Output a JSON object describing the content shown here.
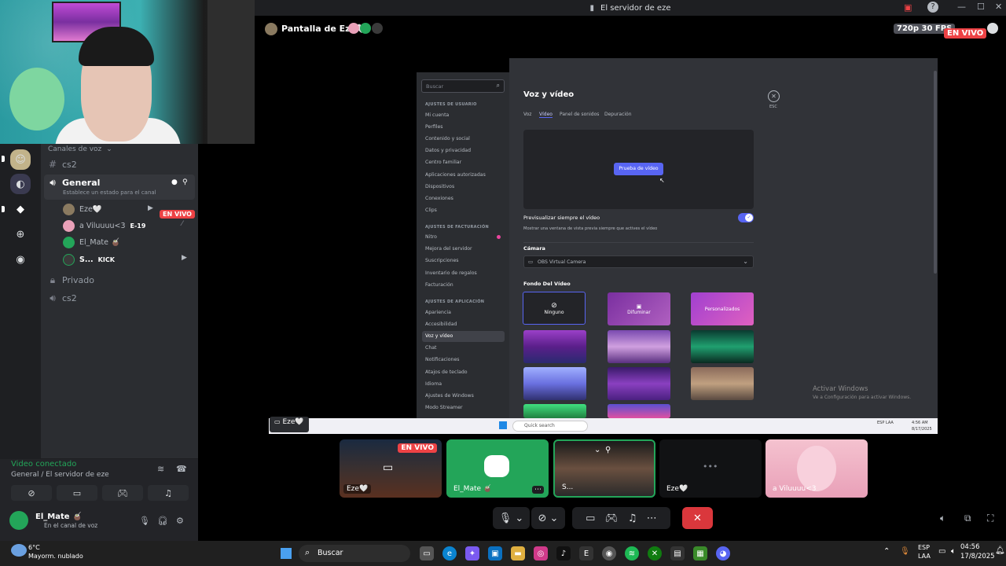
{
  "window": {
    "title": "El servidor de eze"
  },
  "stream": {
    "title": "Pantalla de Eze🤍",
    "quality": "720p 30 FPS",
    "live_badge": "EN VIVO"
  },
  "sidebar": {
    "category": "Canales de voz",
    "channels": [
      {
        "name": "cs2",
        "type": "text"
      },
      {
        "name": "General",
        "type": "voice",
        "status": "Establece un estado para el canal"
      },
      {
        "name": "Privado",
        "type": "locked"
      },
      {
        "name": "cs2",
        "type": "voice"
      }
    ],
    "voice_users": [
      {
        "name": "Eze🤍",
        "live": "EN VIVO"
      },
      {
        "name": "a Viluuuu<3",
        "tag": "E-19"
      },
      {
        "name": "El_Mate 🧉"
      },
      {
        "name": "S...",
        "tag": "KICK"
      }
    ]
  },
  "voice_panel": {
    "status": "Video conectado",
    "location": "General / El servidor de eze",
    "user_name": "El_Mate 🧉",
    "user_status": "En el canal de voz"
  },
  "settings": {
    "search_placeholder": "Buscar",
    "user_header": "AJUSTES DE USUARIO",
    "user_items": [
      "Mi cuenta",
      "Perfiles",
      "Contenido y social",
      "Datos y privacidad",
      "Centro familiar",
      "Aplicaciones autorizadas",
      "Dispositivos",
      "Conexiones",
      "Clips"
    ],
    "billing_header": "AJUSTES DE FACTURACIÓN",
    "billing_items": [
      "Nitro",
      "Mejora del servidor",
      "Suscripciones",
      "Inventario de regalos",
      "Facturación"
    ],
    "app_header": "AJUSTES DE APLICACIÓN",
    "app_items": [
      "Apariencia",
      "Accesibilidad",
      "Voz y vídeo",
      "Chat",
      "Notificaciones",
      "Atajos de teclado",
      "Idioma",
      "Ajustes de Windows",
      "Modo Streamer"
    ],
    "page_title": "Voz y vídeo",
    "tabs": [
      "Voz",
      "Vídeo",
      "Panel de sonidos",
      "Depuración"
    ],
    "test_button": "Prueba de vídeo",
    "preview_label": "Previsualizar siempre el vídeo",
    "preview_desc": "Mostrar una ventana de vista previa siempre que actives el vídeo",
    "camera_label": "Cámara",
    "camera_value": "OBS Virtual Camera",
    "bg_label": "Fondo Del Vídeo",
    "bg_none": "Ninguno",
    "bg_blur": "Difuminar",
    "bg_custom": "Personalizados",
    "esc": "ESC",
    "activate_title": "Activar Windows",
    "activate_desc": "Ve a Configuración para activar Windows."
  },
  "inner_taskbar": {
    "search": "Quick search",
    "lang": "ESP LAA",
    "time": "4:56 AM",
    "date": "8/17/2025",
    "eze_label": "Eze🤍"
  },
  "tiles": [
    {
      "name": "Eze🤍",
      "badge": "EN VIVO"
    },
    {
      "name": "El_Mate 🧉"
    },
    {
      "name": "S..."
    },
    {
      "name": "Eze🤍"
    },
    {
      "name": "a Viluuuu<3"
    }
  ],
  "windows_taskbar": {
    "weather_temp": "6°C",
    "weather_desc": "Mayorm. nublado",
    "search": "Buscar",
    "lang1": "ESP",
    "lang2": "LAA",
    "time": "04:56",
    "date": "17/8/2025"
  },
  "colors": {
    "live": "#ed4245",
    "blurple": "#5865f2",
    "green": "#23a559"
  }
}
